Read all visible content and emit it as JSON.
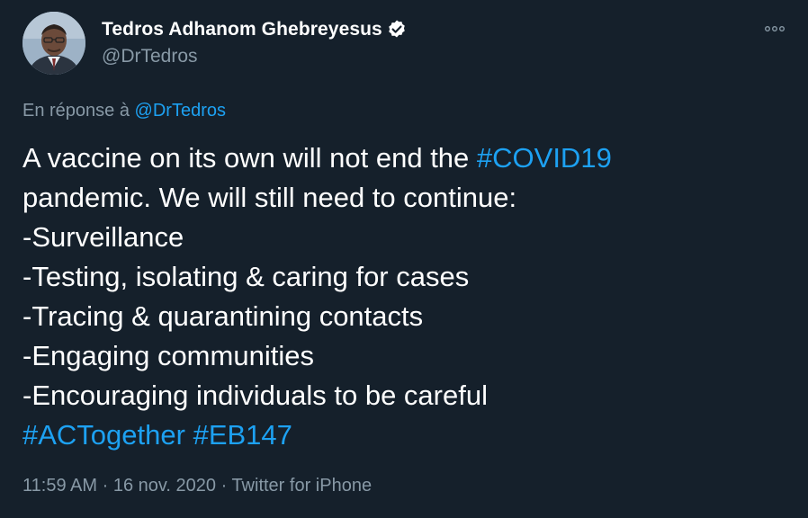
{
  "author": {
    "name": "Tedros Adhanom Ghebreyesus",
    "handle": "@DrTedros",
    "verified_icon": "verified-badge-icon",
    "avatar": "profile-photo"
  },
  "more_icon": "more-options-icon",
  "reply_context": {
    "prefix": "En réponse à",
    "mention": "@DrTedros"
  },
  "tweet": {
    "line1_text": "A vaccine on its own will not end the ",
    "line1_tag": "#COVID19",
    "line2": "pandemic. We will still need to continue:",
    "line3": "-Surveillance",
    "line4": "-Testing, isolating & caring for cases",
    "line5": "-Tracing & quarantining contacts",
    "line6": "-Engaging communities",
    "line7": "-Encouraging individuals to be careful",
    "tags": [
      "#ACTogether",
      "#EB147"
    ]
  },
  "meta": {
    "time": "11:59 AM",
    "date": "16 nov. 2020",
    "source": "Twitter for iPhone",
    "separator": "·"
  },
  "colors": {
    "background": "#15202b",
    "text": "#ffffff",
    "muted": "#8899a6",
    "link": "#1da1f2"
  }
}
